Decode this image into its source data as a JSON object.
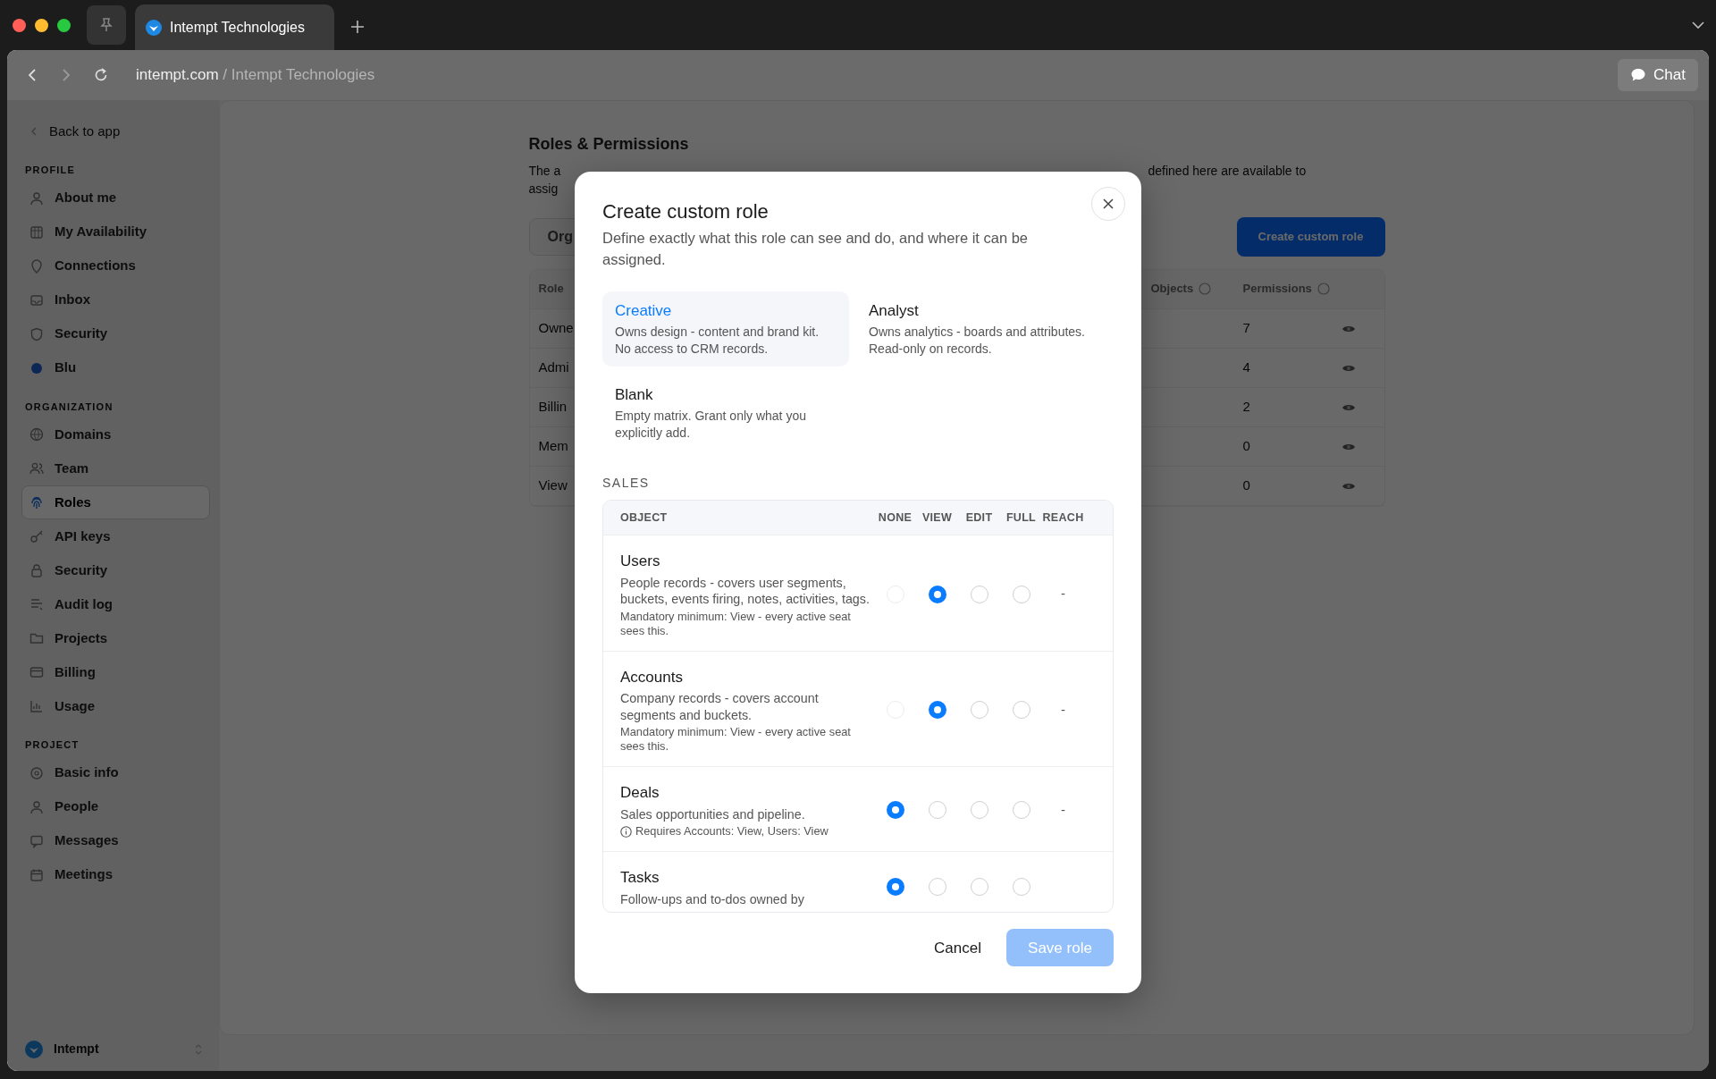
{
  "browser": {
    "tab": {
      "title": "Intempt Technologies"
    },
    "address": {
      "domain": "intempt.com",
      "separator": "/",
      "page": "Intempt Technologies"
    },
    "chat_button": "Chat"
  },
  "sidebar": {
    "back_link": "Back to app",
    "sections": [
      {
        "title": "PROFILE",
        "items": [
          {
            "label": "About me",
            "selected": false
          },
          {
            "label": "My Availability",
            "selected": false
          },
          {
            "label": "Connections",
            "selected": false
          },
          {
            "label": "Inbox",
            "selected": false
          },
          {
            "label": "Security",
            "selected": false
          },
          {
            "label": "Blu",
            "selected": false
          }
        ]
      },
      {
        "title": "ORGANIZATION",
        "items": [
          {
            "label": "Domains",
            "selected": false
          },
          {
            "label": "Team",
            "selected": false
          },
          {
            "label": "Roles",
            "selected": true
          },
          {
            "label": "API keys",
            "selected": false
          },
          {
            "label": "Security",
            "selected": false
          },
          {
            "label": "Audit log",
            "selected": false
          },
          {
            "label": "Projects",
            "selected": false
          },
          {
            "label": "Billing",
            "selected": false
          },
          {
            "label": "Usage",
            "selected": false
          }
        ]
      },
      {
        "title": "PROJECT",
        "items": [
          {
            "label": "Basic info",
            "selected": false
          },
          {
            "label": "People",
            "selected": false
          },
          {
            "label": "Messages",
            "selected": false
          },
          {
            "label": "Meetings",
            "selected": false
          }
        ]
      }
    ],
    "footer": {
      "label": "Intempt"
    }
  },
  "page": {
    "title": "Roles & Permissions",
    "description_fragments": [
      "The a",
      "defined here are available to",
      "assig"
    ],
    "scope_tab": "Org",
    "create_button": "Create custom role",
    "table": {
      "columns": [
        "Role",
        "Objects",
        "Permissions"
      ],
      "rows": [
        {
          "role": "Owne",
          "permissions": "7"
        },
        {
          "role": "Admi",
          "permissions": "4"
        },
        {
          "role": "Billin",
          "permissions": "2"
        },
        {
          "role": "Mem",
          "permissions": "0"
        },
        {
          "role": "View",
          "permissions": "0"
        }
      ]
    }
  },
  "modal": {
    "title": "Create custom role",
    "subtitle": "Define exactly what this role can see and do, and where it can be assigned.",
    "presets": [
      {
        "name": "Creative",
        "description": "Owns design - content and brand kit. No access to CRM records.",
        "selected": true
      },
      {
        "name": "Analyst",
        "description": "Owns analytics - boards and attributes. Read-only on records.",
        "selected": false
      },
      {
        "name": "Blank",
        "description": "Empty matrix. Grant only what you explicitly add.",
        "selected": false
      }
    ],
    "section": "SALES",
    "columns": [
      "OBJECT",
      "NONE",
      "VIEW",
      "EDIT",
      "FULL",
      "REACH"
    ],
    "rows": [
      {
        "name": "Users",
        "description": "People records - covers user segments, buckets, events firing, notes, activities, tags.",
        "note": {
          "kind": "plain",
          "text": "Mandatory minimum: View - every active seat sees this."
        },
        "options": [
          {
            "selected": false,
            "disabled": true
          },
          {
            "selected": true,
            "disabled": false
          },
          {
            "selected": false,
            "disabled": false
          },
          {
            "selected": false,
            "disabled": false
          }
        ],
        "reach": "-"
      },
      {
        "name": "Accounts",
        "description": "Company records - covers account segments and buckets.",
        "note": {
          "kind": "plain",
          "text": "Mandatory minimum: View - every active seat sees this."
        },
        "options": [
          {
            "selected": false,
            "disabled": true
          },
          {
            "selected": true,
            "disabled": false
          },
          {
            "selected": false,
            "disabled": false
          },
          {
            "selected": false,
            "disabled": false
          }
        ],
        "reach": "-"
      },
      {
        "name": "Deals",
        "description": "Sales opportunities and pipeline.",
        "note": {
          "kind": "info",
          "text": "Requires Accounts: View, Users: View"
        },
        "options": [
          {
            "selected": true,
            "disabled": false
          },
          {
            "selected": false,
            "disabled": false
          },
          {
            "selected": false,
            "disabled": false
          },
          {
            "selected": false,
            "disabled": false
          }
        ],
        "reach": "-"
      },
      {
        "name": "Tasks",
        "description": "Follow-ups and to-dos owned by",
        "options": [
          {
            "selected": true,
            "disabled": false
          },
          {
            "selected": false,
            "disabled": false
          },
          {
            "selected": false,
            "disabled": false
          },
          {
            "selected": false,
            "disabled": false
          }
        ]
      }
    ],
    "cancel_button": "Cancel",
    "save_button": {
      "label": "Save role",
      "disabled": true
    }
  }
}
